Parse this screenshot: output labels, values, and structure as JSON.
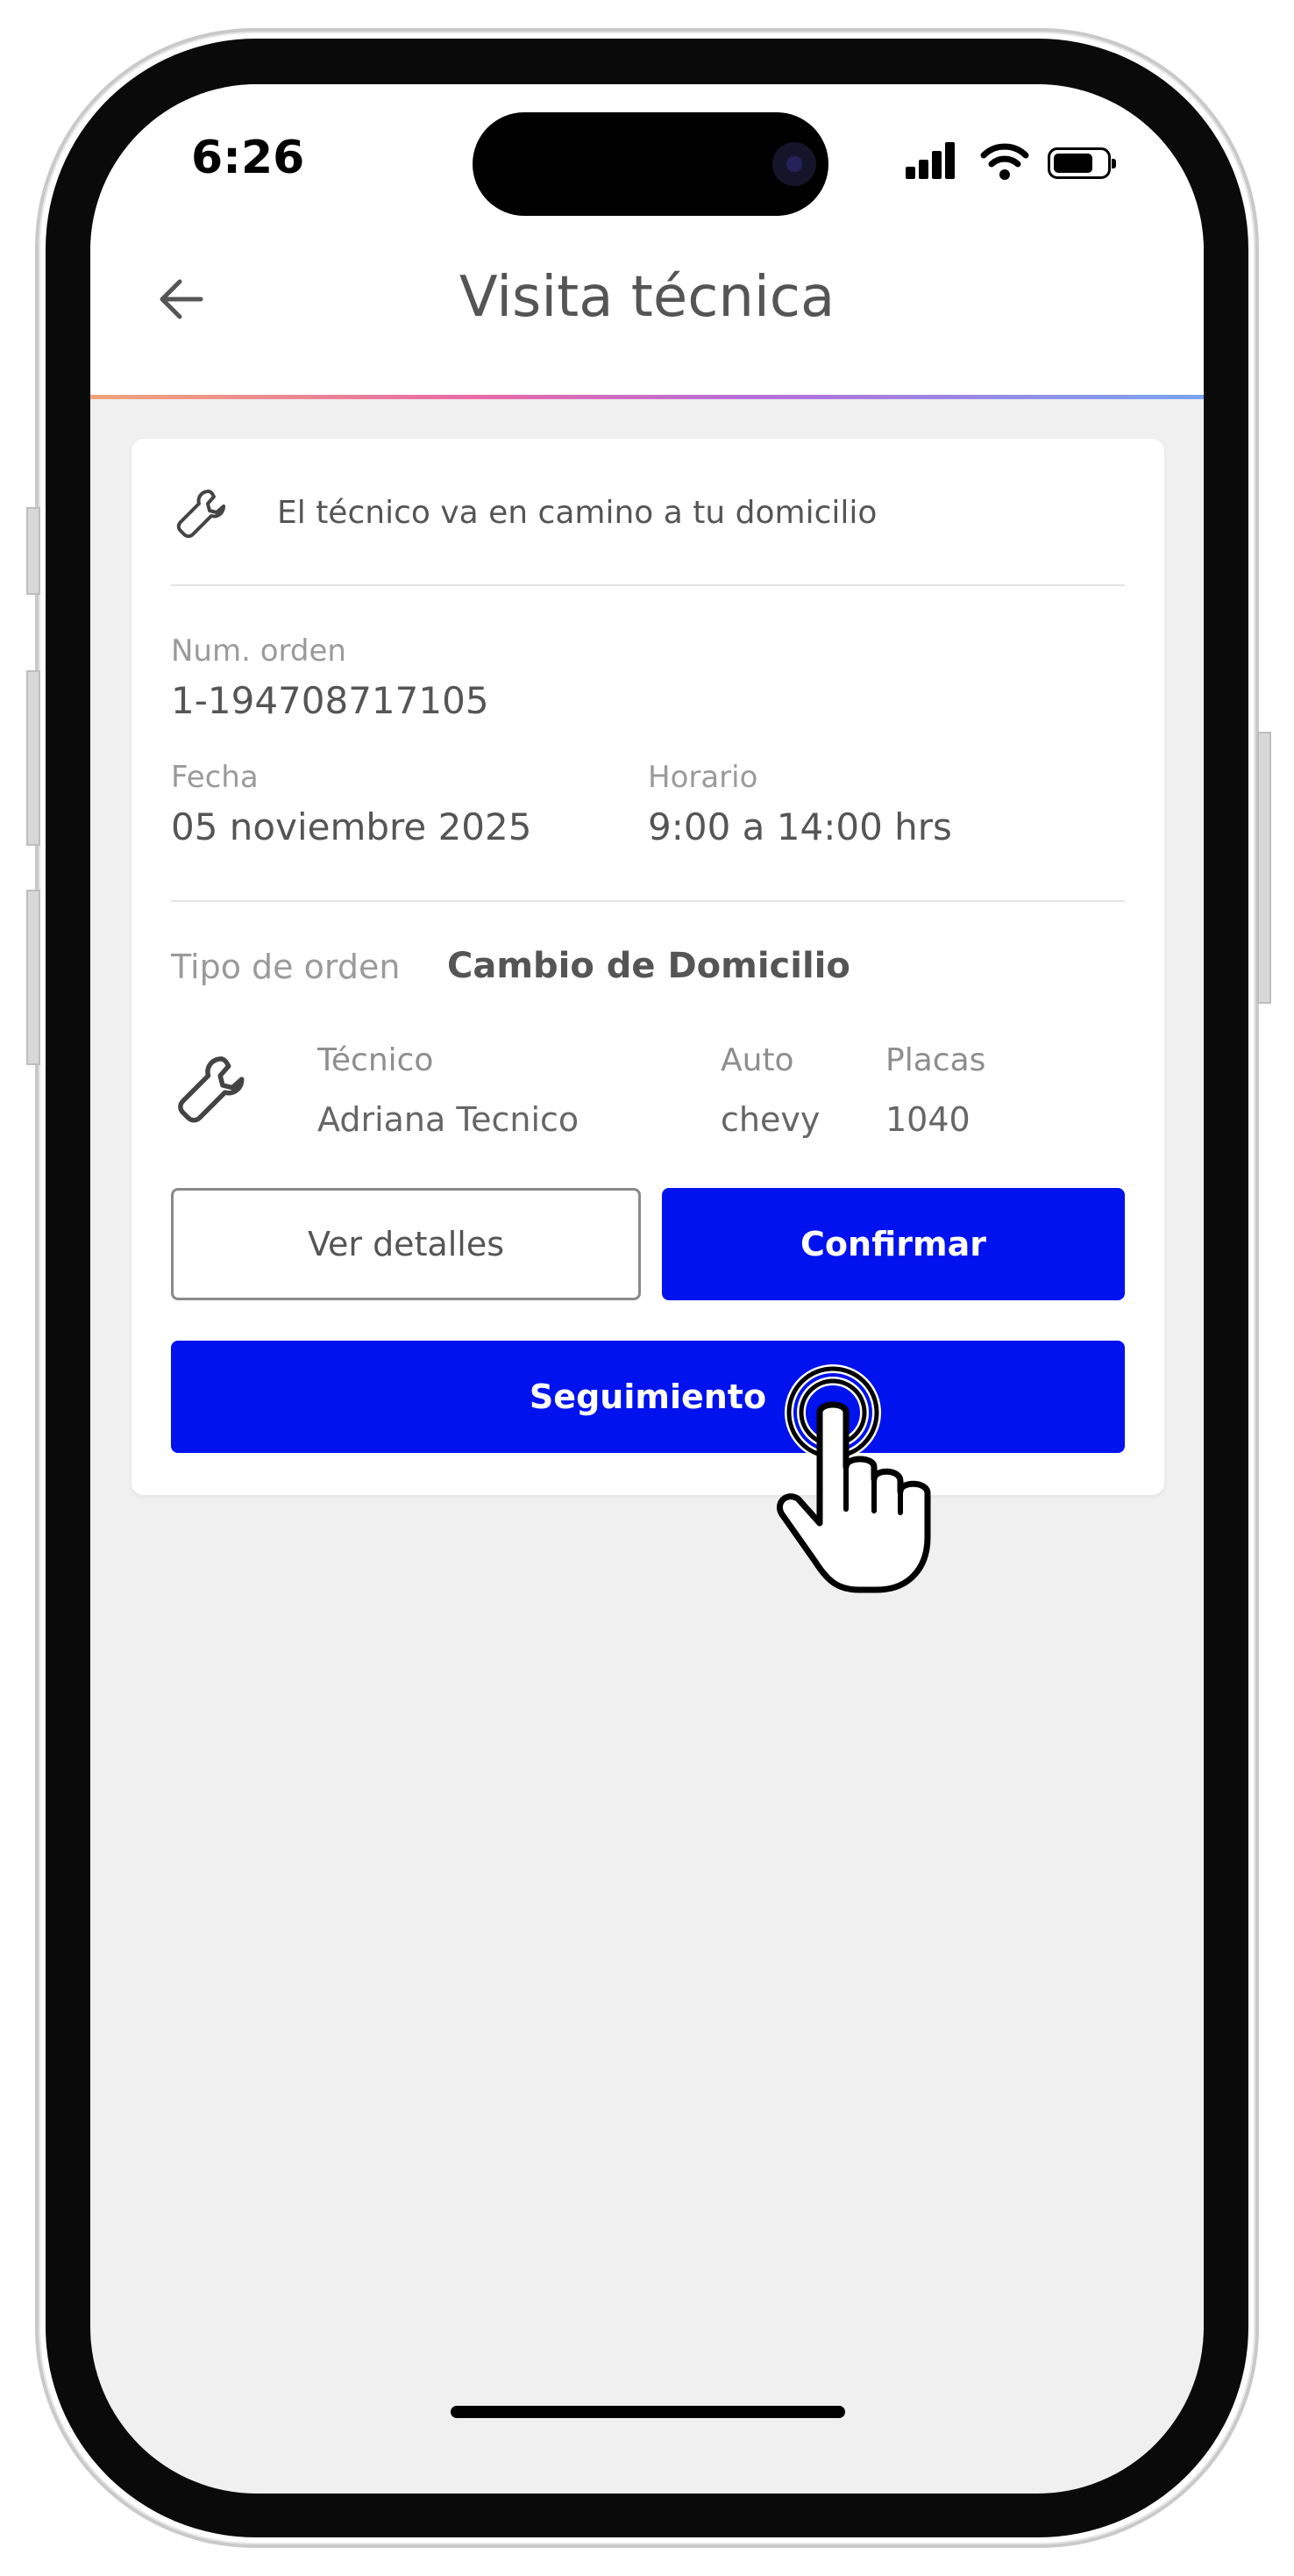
{
  "status_bar": {
    "time": "6:26"
  },
  "header": {
    "title": "Visita técnica"
  },
  "card": {
    "status_message": "El técnico va en camino a tu domicilio",
    "order_number_label": "Num. orden",
    "order_number": "1-194708717105",
    "date_label": "Fecha",
    "date": "05 noviembre 2025",
    "schedule_label": "Horario",
    "schedule": "9:00 a 14:00 hrs",
    "order_type_label": "Tipo de orden",
    "order_type": "Cambio de Domicilio",
    "technician_label": "Técnico",
    "technician": "Adriana Tecnico",
    "car_label": "Auto",
    "car": "chevy",
    "plates_label": "Placas",
    "plates": "1040"
  },
  "buttons": {
    "details": "Ver detalles",
    "confirm": "Confirmar",
    "follow": "Seguimiento"
  },
  "colors": {
    "primary": "#0012ee",
    "background": "#f0f0f0",
    "card": "#ffffff"
  },
  "icons": [
    "back-arrow-icon",
    "wrench-icon",
    "signal-icon",
    "wifi-icon",
    "battery-icon",
    "tap-hand-icon"
  ]
}
